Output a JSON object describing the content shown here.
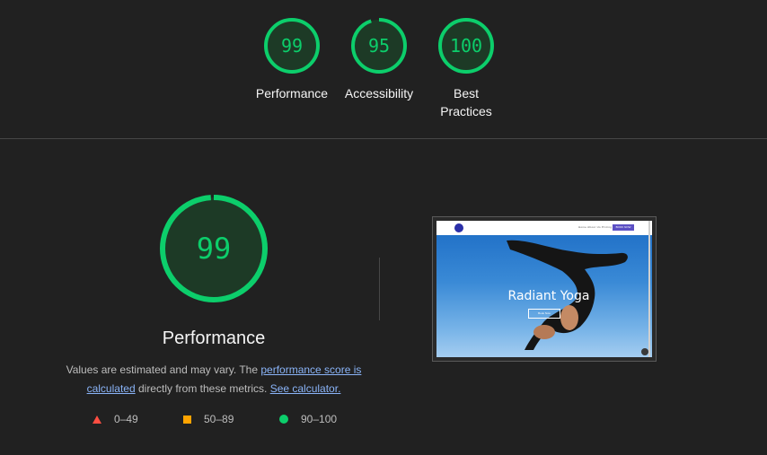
{
  "scores": [
    {
      "label": "Performance",
      "value": "99"
    },
    {
      "label": "Accessibility",
      "value": "95"
    },
    {
      "label": "Best Practices",
      "value": "100"
    }
  ],
  "main": {
    "score": "99",
    "title": "Performance",
    "desc_prefix": "Values are estimated and may vary. The ",
    "perf_link": "performance score is calculated",
    "desc_middle": " directly from these metrics. ",
    "calc_link": "See calculator."
  },
  "legend": [
    {
      "range": "0–49",
      "icon": "triangle-icon",
      "color": "#ff4e42"
    },
    {
      "range": "50–89",
      "icon": "square-icon",
      "color": "#ffa400"
    },
    {
      "range": "90–100",
      "icon": "circle-icon",
      "color": "#0cce6b"
    }
  ],
  "thumbnail": {
    "hero_title": "Radiant Yoga",
    "nav_links": "Home  About Us  Pricing",
    "nav_button": "BOOK NOW",
    "cta": "Book Now"
  },
  "colors": {
    "pass": "#0cce6b",
    "average": "#ffa400",
    "fail": "#ff4e42",
    "background": "#212121"
  }
}
